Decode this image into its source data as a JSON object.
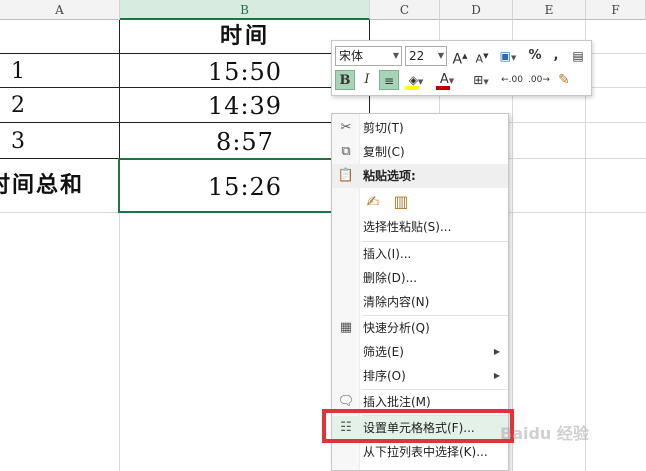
{
  "columns": [
    "A",
    "B",
    "C",
    "D",
    "E",
    "F"
  ],
  "selected_column": "B",
  "header_cell": "时间",
  "rows": [
    {
      "a": "1",
      "b": "15:50"
    },
    {
      "a": "2",
      "b": "14:39"
    },
    {
      "a": "3",
      "b": "8:57"
    }
  ],
  "total": {
    "a": "时间总和",
    "b": "15:26"
  },
  "mini_toolbar": {
    "font": "宋体",
    "size": "22",
    "grow_font": "A",
    "shrink_font": "A",
    "percent": "%",
    "comma": ",",
    "bold": "B",
    "italic": "I",
    "font_color_letter": "A",
    "inc_decimal": ".00",
    "dec_decimal": ".00",
    "accent_color": "#217346",
    "highlight_color": "#ffff00",
    "font_color": "#c00000"
  },
  "context_menu": {
    "items": [
      {
        "label": "剪切(T)",
        "icon": "cut-icon"
      },
      {
        "label": "复制(C)",
        "icon": "copy-icon"
      },
      {
        "label": "粘贴选项:",
        "icon": "paste-icon"
      },
      {
        "label": "选择性粘贴(S)..."
      },
      {
        "label": "插入(I)..."
      },
      {
        "label": "删除(D)..."
      },
      {
        "label": "清除内容(N)"
      },
      {
        "label": "快速分析(Q)",
        "icon": "quick-analysis-icon"
      },
      {
        "label": "筛选(E)",
        "submenu": true
      },
      {
        "label": "排序(O)",
        "submenu": true
      },
      {
        "label": "插入批注(M)",
        "icon": "comment-icon"
      },
      {
        "label": "设置单元格格式(F)...",
        "icon": "format-cells-icon"
      },
      {
        "label": "从下拉列表中选择(K)..."
      }
    ]
  },
  "highlight_color": "#e0343a",
  "watermark": "Baidu 经验"
}
